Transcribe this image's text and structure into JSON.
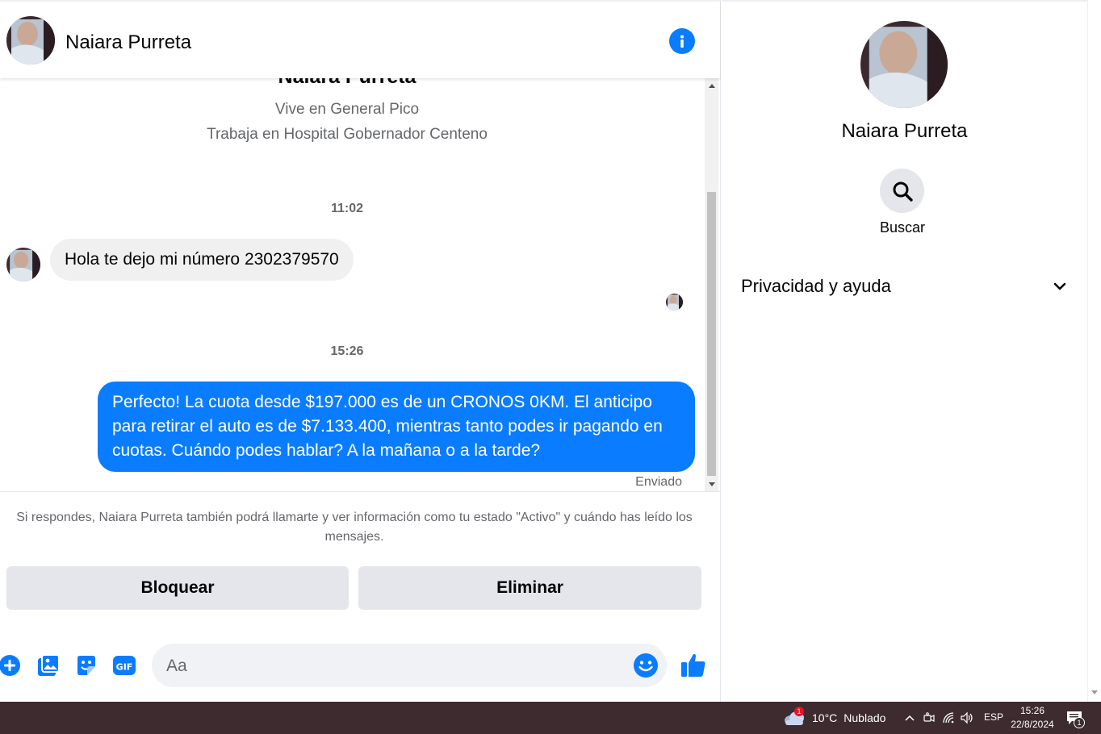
{
  "contact": {
    "name": "Naiara Purreta",
    "lives": "Vive en General Pico",
    "works": "Trabaja en Hospital Gobernador Centeno"
  },
  "messages": {
    "time1": "11:02",
    "incoming": "Hola te dejo mi número 2302379570",
    "time2": "15:26",
    "outgoing": "Perfecto! La cuota desde $197.000 es de un CRONOS 0KM. El anticipo para retirar el auto es de $7.133.400, mientras tanto podes ir pagando en cuotas. Cuándo podes hablar? A la mañana o a la tarde?",
    "status": "Enviado"
  },
  "notice": "Si respondes, Naiara Purreta también podrá llamarte y ver información como tu estado \"Activo\" y cuándo has leído los mensajes.",
  "actions": {
    "block": "Bloquear",
    "delete": "Eliminar"
  },
  "composer": {
    "placeholder": "Aa"
  },
  "sidebar": {
    "search_label": "Buscar",
    "privacy_label": "Privacidad y ayuda"
  },
  "icons": {
    "info": "info-icon",
    "plus": "plus-circle-icon",
    "photo": "photo-icon",
    "sticker": "sticker-icon",
    "gif": "gif-icon",
    "emoji": "emoji-icon",
    "like": "thumbs-up-icon",
    "search": "search-icon",
    "chevron": "chevron-down-icon"
  },
  "colors": {
    "accent": "#0a7cff",
    "bubble_in": "#f0f0f0",
    "taskbar": "#3d2b2f"
  },
  "taskbar": {
    "weather_badge": "1",
    "temperature": "10°C",
    "condition": "Nublado",
    "language": "ESP",
    "time": "15:26",
    "date": "22/8/2024",
    "notifications": "1"
  }
}
